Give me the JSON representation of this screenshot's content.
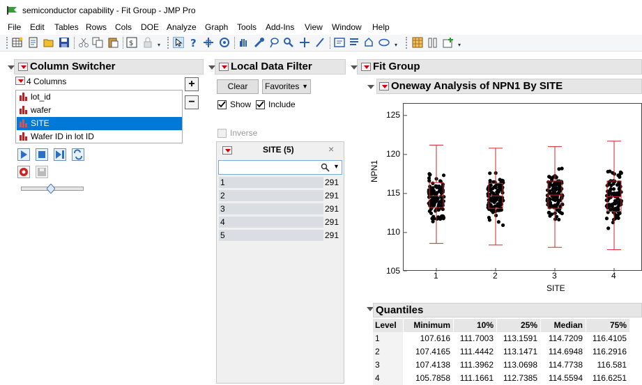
{
  "window": {
    "title": "semiconductor capability - Fit Group - JMP Pro"
  },
  "menu": [
    "File",
    "Edit",
    "Tables",
    "Rows",
    "Cols",
    "DOE",
    "Analyze",
    "Graph",
    "Tools",
    "Add-Ins",
    "View",
    "Window",
    "Help"
  ],
  "column_switcher": {
    "title": "Column Switcher",
    "count_label": "4 Columns",
    "columns": [
      "lot_id",
      "wafer",
      "SITE",
      "Wafer ID in lot ID"
    ],
    "selected_index": 2,
    "slider_level": 0.48
  },
  "local_data_filter": {
    "title": "Local Data Filter",
    "clear_label": "Clear",
    "favorites_label": "Favorites",
    "show_label": "Show",
    "include_label": "Include",
    "inverse_label": "Inverse",
    "show_checked": true,
    "include_checked": true,
    "inverse_checked": false,
    "site_header": "SITE (5)",
    "levels": [
      {
        "name": "1",
        "count": "291"
      },
      {
        "name": "2",
        "count": "291"
      },
      {
        "name": "3",
        "count": "291"
      },
      {
        "name": "4",
        "count": "291"
      },
      {
        "name": "5",
        "count": "291"
      }
    ]
  },
  "fit_group": {
    "title": "Fit Group",
    "oneway_title": "Oneway Analysis of NPN1 By SITE"
  },
  "chart_data": {
    "type": "scatter",
    "title": "",
    "xlabel": "SITE",
    "ylabel": "NPN1",
    "categories": [
      "1",
      "2",
      "3",
      "4"
    ],
    "yticks": [
      105,
      110,
      115,
      120,
      125
    ],
    "ylim": [
      105,
      126.5
    ],
    "point_color": "#000000",
    "box_color": "#d4232a",
    "quantiles": [
      {
        "site": "1",
        "min": 108.6,
        "q10": 111.7,
        "q25": 113.2,
        "median": 114.7,
        "q75": 116.4,
        "max": 121.2
      },
      {
        "site": "2",
        "min": 108.4,
        "q10": 111.4,
        "q25": 113.1,
        "median": 114.7,
        "q75": 116.3,
        "max": 120.8
      },
      {
        "site": "3",
        "min": 108.1,
        "q10": 111.4,
        "q25": 113.1,
        "median": 114.8,
        "q75": 116.6,
        "max": 121.0
      },
      {
        "site": "4",
        "min": 107.8,
        "q10": 111.2,
        "q25": 112.7,
        "median": 114.6,
        "q75": 116.6,
        "max": 121.7
      }
    ]
  },
  "quantiles": {
    "title": "Quantiles",
    "headers": [
      "Level",
      "Minimum",
      "10%",
      "25%",
      "Median",
      "75%"
    ],
    "rows": [
      [
        "1",
        "107.616",
        "111.7003",
        "113.1591",
        "114.7209",
        "116.4105"
      ],
      [
        "2",
        "107.4165",
        "111.4442",
        "113.1471",
        "114.6948",
        "116.2916"
      ],
      [
        "3",
        "107.4138",
        "111.3962",
        "113.0698",
        "114.7738",
        "116.581"
      ],
      [
        "4",
        "105.7858",
        "111.1661",
        "112.7385",
        "114.5594",
        "116.6251"
      ]
    ]
  }
}
